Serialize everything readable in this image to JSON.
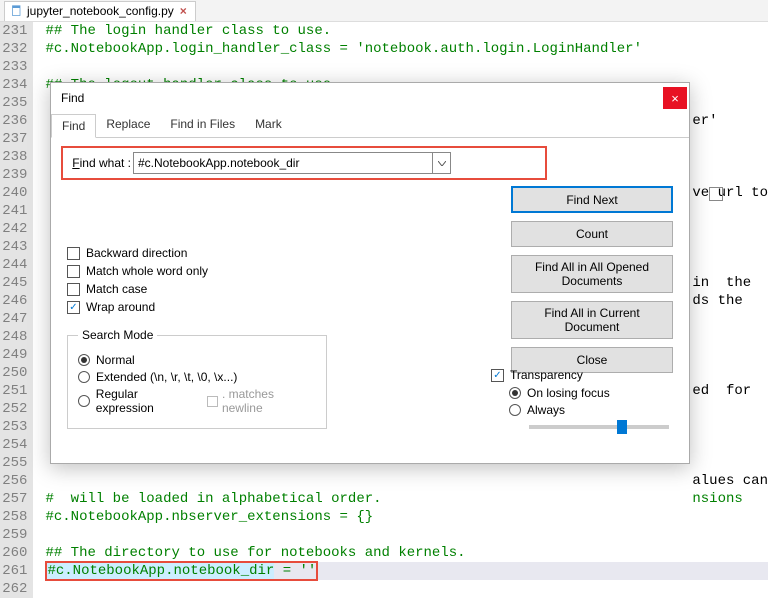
{
  "file_tab": {
    "name": "jupyter_notebook_config.py",
    "close": "×"
  },
  "code_lines": [
    {
      "n": 231,
      "t": "## The login handler class to use.",
      "cls": "comment"
    },
    {
      "n": 232,
      "t": "#c.NotebookApp.login_handler_class = 'notebook.auth.login.LoginHandler'",
      "cls": "comment"
    },
    {
      "n": 233,
      "t": "",
      "cls": "plain"
    },
    {
      "n": 234,
      "t": "## The logout handler class to use.",
      "cls": "comment"
    },
    {
      "n": 235,
      "t": "",
      "cls": "plain"
    },
    {
      "n": 236,
      "t": "                                                                             er'",
      "cls": "plain"
    },
    {
      "n": 237,
      "t": "",
      "cls": "plain"
    },
    {
      "n": 238,
      "t": "",
      "cls": "plain"
    },
    {
      "n": 239,
      "t": "",
      "cls": "plain"
    },
    {
      "n": 240,
      "t": "                                                                             ve url to",
      "cls": "plain"
    },
    {
      "n": 241,
      "t": "",
      "cls": "plain"
    },
    {
      "n": 242,
      "t": "",
      "cls": "plain"
    },
    {
      "n": 243,
      "t": "",
      "cls": "plain"
    },
    {
      "n": 244,
      "t": "",
      "cls": "plain"
    },
    {
      "n": 245,
      "t": "                                                                             in  the",
      "cls": "plain"
    },
    {
      "n": 246,
      "t": "                                                                             ds the",
      "cls": "plain"
    },
    {
      "n": 247,
      "t": "",
      "cls": "plain"
    },
    {
      "n": 248,
      "t": "",
      "cls": "plain"
    },
    {
      "n": 249,
      "t": "",
      "cls": "plain"
    },
    {
      "n": 250,
      "t": "",
      "cls": "plain"
    },
    {
      "n": 251,
      "t": "                                                                             ed  for",
      "cls": "plain"
    },
    {
      "n": 252,
      "t": "",
      "cls": "plain"
    },
    {
      "n": 253,
      "t": "",
      "cls": "plain"
    },
    {
      "n": 254,
      "t": "",
      "cls": "plain"
    },
    {
      "n": 255,
      "t": "",
      "cls": "plain"
    },
    {
      "n": 256,
      "t": "                                                                             alues can",
      "cls": "plain"
    },
    {
      "n": 257,
      "t": "#  will be loaded in alphabetical order.                                     nsions",
      "cls": "comment"
    },
    {
      "n": 258,
      "t": "#c.NotebookApp.nbserver_extensions = {}",
      "cls": "comment"
    },
    {
      "n": 259,
      "t": "",
      "cls": "plain"
    },
    {
      "n": 260,
      "t": "## The directory to use for notebooks and kernels.",
      "cls": "comment"
    },
    {
      "n": 261,
      "t": "#c.NotebookApp.notebook_dir = ''",
      "cls": "comment"
    },
    {
      "n": 262,
      "t": "",
      "cls": "plain"
    }
  ],
  "highlighted_line_index": 31,
  "dialog": {
    "title": "Find",
    "tabs": [
      "Find",
      "Replace",
      "Find in Files",
      "Mark"
    ],
    "active_tab": 0,
    "find_label": "Find what :",
    "find_value": "#c.NotebookApp.notebook_dir",
    "buttons": {
      "find_next": "Find Next",
      "count": "Count",
      "find_all_opened": "Find All in All Opened Documents",
      "find_all_current": "Find All in Current Document",
      "close": "Close"
    },
    "options": {
      "backward": "Backward direction",
      "whole_word": "Match whole word only",
      "match_case": "Match case",
      "wrap": "Wrap around",
      "wrap_checked": true
    },
    "search_mode": {
      "legend": "Search Mode",
      "normal": "Normal",
      "extended": "Extended (\\n, \\r, \\t, \\0, \\x...)",
      "regex": "Regular expression",
      "matches_newline": ". matches newline",
      "selected": "normal"
    },
    "transparency": {
      "label": "Transparency",
      "checked": true,
      "on_losing_focus": "On losing focus",
      "always": "Always",
      "selected": "on_losing_focus",
      "slider_pct": 63
    }
  }
}
